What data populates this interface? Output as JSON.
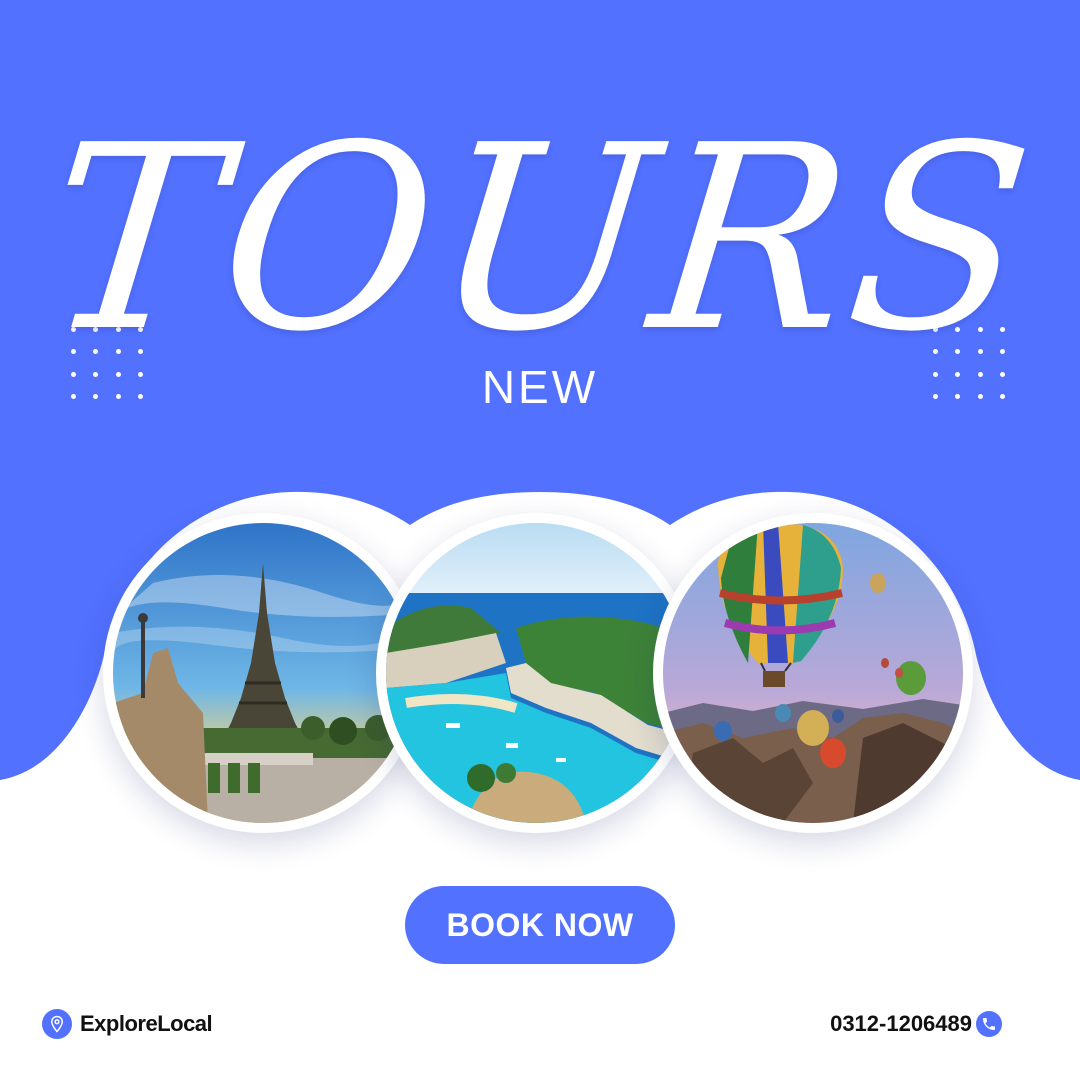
{
  "colors": {
    "brand_blue": "#5271ff",
    "background": "#ffffff",
    "text_dark": "#111111"
  },
  "header": {
    "title": "TOURS",
    "subtitle": "NEW"
  },
  "photos": [
    {
      "subject": "eiffel-tower-paris"
    },
    {
      "subject": "navagio-beach-cliffs"
    },
    {
      "subject": "hot-air-balloons-cappadocia"
    }
  ],
  "cta": {
    "label": "BOOK NOW"
  },
  "brand": {
    "name": "ExploreLocal",
    "icon": "location-pin-icon"
  },
  "contact": {
    "phone": "0312-1206489",
    "icon": "phone-icon"
  }
}
